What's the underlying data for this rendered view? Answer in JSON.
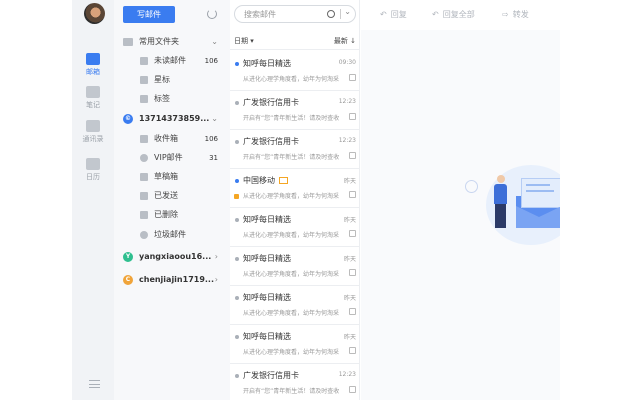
{
  "compose_label": "写邮件",
  "rail": [
    {
      "label": "邮箱",
      "icon": "mailbox-icon",
      "active": true
    },
    {
      "label": "笔记",
      "icon": "note-icon",
      "active": false
    },
    {
      "label": "通讯录",
      "icon": "contacts-icon",
      "active": false
    },
    {
      "label": "日历",
      "icon": "calendar-icon",
      "active": false
    }
  ],
  "common_folders_label": "常用文件夹",
  "common": [
    {
      "label": "未读邮件",
      "count": "106",
      "icon": "unread-icon"
    },
    {
      "label": "星标",
      "count": "",
      "icon": "star-icon"
    },
    {
      "label": "标签",
      "count": "",
      "icon": "tag-icon"
    }
  ],
  "account1": {
    "name": "13714373859...",
    "badge": "©",
    "color": "#3a7cf0"
  },
  "account1_folders": [
    {
      "label": "收件箱",
      "count": "106",
      "icon": "inbox-icon"
    },
    {
      "label": "VIP邮件",
      "count": "31",
      "icon": "vip-icon"
    },
    {
      "label": "草稿箱",
      "count": "",
      "icon": "draft-icon"
    },
    {
      "label": "已发送",
      "count": "",
      "icon": "sent-icon"
    },
    {
      "label": "已删除",
      "count": "",
      "icon": "trash-icon"
    },
    {
      "label": "垃圾邮件",
      "count": "",
      "icon": "spam-icon"
    }
  ],
  "account2": {
    "name": "yangxiaoou16...",
    "badge": "Y",
    "color": "#2fbf8f"
  },
  "account3": {
    "name": "chenjiajin1719...",
    "badge": "C",
    "color": "#f0a43a"
  },
  "search_placeholder": "搜索邮件",
  "sort": {
    "left": "日期",
    "right": "最新"
  },
  "toolbar": {
    "reply": "回复",
    "reply_all": "回复全部",
    "forward": "转发"
  },
  "mails": [
    {
      "sender": "知呼每日精选",
      "time": "09:30",
      "snippet": "从进化心理学角度看，幼年为何淘采衣...",
      "unread": true,
      "attach": true
    },
    {
      "sender": "广发银行信用卡",
      "time": "12:23",
      "snippet": "开启有“您”青年新生活！请及时查收...",
      "unread": false,
      "attach": true
    },
    {
      "sender": "广发银行信用卡",
      "time": "12:23",
      "snippet": "开启有“您”青年新生活！请及时查收...",
      "unread": false,
      "attach": true
    },
    {
      "sender": "中国移动",
      "time": "昨天",
      "snippet": "从进化心理学角度看，幼年为何淘采衣...",
      "unread": true,
      "attach": true,
      "flag": true,
      "tag": true
    },
    {
      "sender": "知呼每日精选",
      "time": "昨天",
      "snippet": "从进化心理学角度看，幼年为何淘采衣...",
      "unread": false,
      "attach": true
    },
    {
      "sender": "知呼每日精选",
      "time": "昨天",
      "snippet": "从进化心理学角度看，幼年为何淘采衣...",
      "unread": false,
      "attach": true
    },
    {
      "sender": "知呼每日精选",
      "time": "昨天",
      "snippet": "从进化心理学角度看，幼年为何淘采衣...",
      "unread": false,
      "attach": true
    },
    {
      "sender": "知呼每日精选",
      "time": "昨天",
      "snippet": "从进化心理学角度看，幼年为何淘采衣...",
      "unread": false,
      "attach": true
    },
    {
      "sender": "广发银行信用卡",
      "time": "12:23",
      "snippet": "开启有“您”青年新生活！请及时查收...",
      "unread": false,
      "attach": true
    }
  ]
}
